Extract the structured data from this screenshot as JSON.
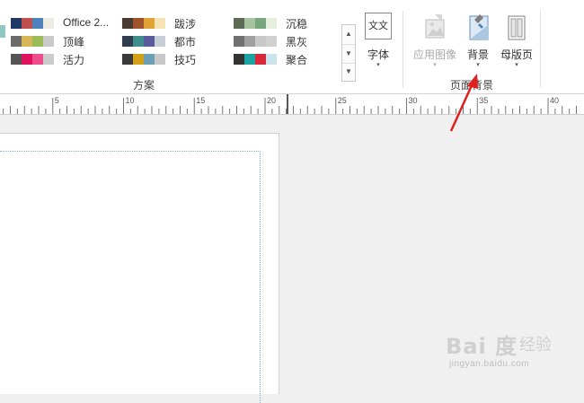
{
  "ribbon": {
    "themes_gallery": {
      "items": [
        {
          "name": "Office 2...",
          "swatches": [
            "#1f3864",
            "#c0504d",
            "#4f81bd",
            "#eeece1"
          ]
        },
        {
          "name": "跋涉",
          "swatches": [
            "#4a3b32",
            "#a0522d",
            "#e3a234",
            "#f6e3b4"
          ]
        },
        {
          "name": "沉稳",
          "swatches": [
            "#5d6a58",
            "#a8c3a0",
            "#7aa67e",
            "#e6eede"
          ]
        },
        {
          "name": "顶峰",
          "swatches": [
            "#6b6b6b",
            "#d6b656",
            "#9bbb59",
            "#c9c9c9"
          ]
        },
        {
          "name": "都市",
          "swatches": [
            "#2f3e4e",
            "#3f8e8c",
            "#5a5a9e",
            "#c6cfd6"
          ]
        },
        {
          "name": "黑灰",
          "swatches": [
            "#707070",
            "#a0a0a0",
            "#c8c8c8",
            "#d0d0d0"
          ]
        },
        {
          "name": "活力",
          "swatches": [
            "#555555",
            "#e0115f",
            "#ee4d8c",
            "#cccccc"
          ]
        },
        {
          "name": "技巧",
          "swatches": [
            "#3a3a3a",
            "#d4a017",
            "#6a9fb5",
            "#c8c8c8"
          ]
        },
        {
          "name": "聚合",
          "swatches": [
            "#333333",
            "#1aa3a3",
            "#d62839",
            "#c9e4ea"
          ]
        }
      ],
      "scroll_up_glyph": "▲",
      "scroll_down_glyph": "▼",
      "more_glyph": "▼"
    },
    "group_schemes_label": "方案",
    "fonts_button": {
      "icon_text": "文文",
      "label": "字体",
      "arrow": "▾"
    },
    "apply_image_button": {
      "label": "应用图像",
      "arrow": "▾"
    },
    "background_button": {
      "label": "背景",
      "arrow": "▾"
    },
    "master_page_button": {
      "label": "母版页",
      "arrow": "▾"
    },
    "group_page_background_label": "页面背景"
  },
  "ruler": {
    "labels": [
      "5",
      "10",
      "15",
      "20",
      "25",
      "30",
      "35",
      "40"
    ]
  },
  "watermark": {
    "brand_text": "Bai 度",
    "brand_suffix": "经验",
    "url": "jingyan.baidu.com"
  },
  "colors": {
    "annotation_arrow": "#e02020",
    "margin_guide": "#7fb3d5"
  }
}
